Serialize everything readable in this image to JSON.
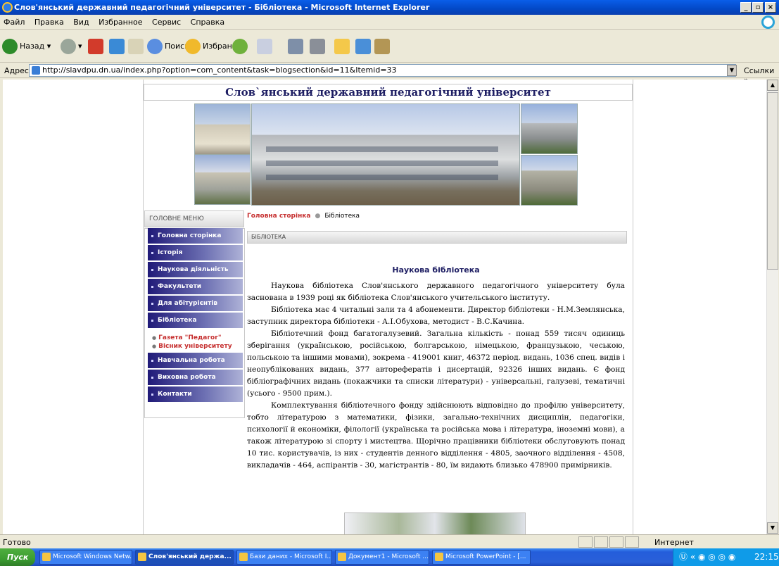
{
  "window": {
    "title": "Слов'янський державний педагогічний університет - Бібліотека - Microsoft Internet Explorer"
  },
  "menubar": [
    "Файл",
    "Правка",
    "Вид",
    "Избранное",
    "Сервис",
    "Справка"
  ],
  "toolbar": {
    "back": "Назад",
    "search": "Поиск",
    "favorites": "Избранное"
  },
  "address": {
    "label": "Адрес:",
    "url": "http://slavdpu.dn.ua/index.php?option=com_content&task=blogsection&id=11&Itemid=33",
    "links": "Ссылки"
  },
  "site": {
    "title": "Слов`янський державний педагогічний університет",
    "menu_title": "ГОЛОВНЕ МЕНЮ",
    "menu": [
      "Головна сторінка",
      "Історія",
      "Наукова діяльність",
      "Факультети",
      "Для абітурієнтів",
      "Бібліотека"
    ],
    "submenu": [
      "Газета \"Педагог\"",
      "Вісник університету"
    ],
    "menu2": [
      "Навчальна робота",
      "Виховна робота",
      "Контакти"
    ],
    "breadcrumb": {
      "home": "Головна сторінка",
      "current": "Бібліотека"
    },
    "section": "БІБЛІОТЕКА"
  },
  "article": {
    "heading": "Наукова бібліотека",
    "paragraphs": [
      "Наукова бібліотека Слов'янського державного педагогічного університету була заснована в 1939 році як бібліотека Слов'янського учительського інституту.",
      "Бібліотека має 4 читальні зали та 4 абонементи. Директор бібліотеки - Н.М.Землянська, заступник директора бібліотеки - А.І.Обухова, методист - В.С.Качина.",
      "Бібліотечний фонд багатогалузевий. Загальна кількість - понад 559 тисяч одиниць зберігання (українською, російською, болгарською, німецькою, французькою, чеською, польською та іншими мовами), зокрема - 419001 книг, 46372 період. видань, 1036 спец. видів і неопублікованих видань, 377 авторефератів і дисертацій, 92326 інших видань. Є фонд бібліографічних видань (покажчики та списки літератури) - універсальні, галузеві, тематичні (усього - 9500 прим.).",
      "Комплектування бібліотечного фонду здійснюють відповідно до профілю університету, тобто літературою з математики, фізики, загально-технічних дисциплін, педагогіки, психології й економіки, філології (українська та російська мова і література, іноземні мови), а також літературою зі спорту і мистецтва. Щорічно працівники бібліотеки обслуговують понад 10 тис. користувачів, із них - студентів денного відділення - 4805, заочного відділення - 4508, викладачів - 464, аспірантів - 30, магістрантів - 80, їм видають близько 478900 примірників."
    ]
  },
  "status": {
    "text": "Готово",
    "zone": "Интернет"
  },
  "taskbar": {
    "start": "Пуск",
    "tasks": [
      "Microsoft Windows Netw...",
      "Слов'янський держа...",
      "Бази даних - Microsoft I...",
      "Документ1 - Microsoft ...",
      "Microsoft PowerPoint - [..."
    ],
    "clock": "22:15"
  }
}
